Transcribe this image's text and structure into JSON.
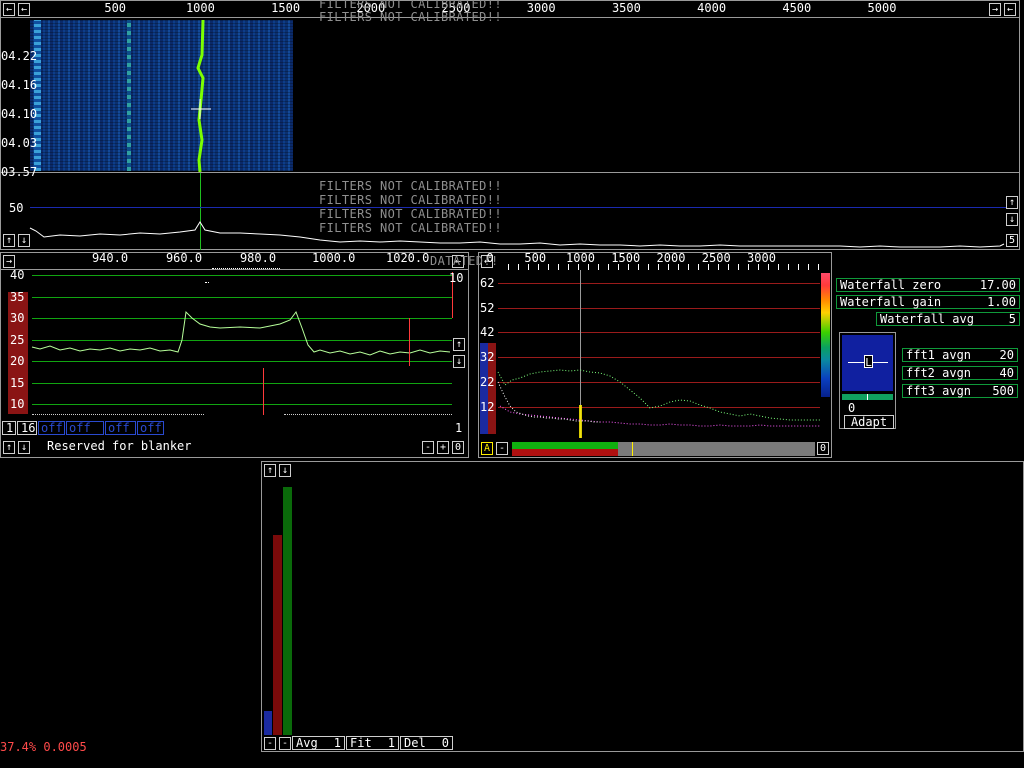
{
  "top_axis": {
    "ticks": [
      {
        "label": "500",
        "freq": 500
      },
      {
        "label": "1000",
        "freq": 1000
      },
      {
        "label": "1500",
        "freq": 1500
      },
      {
        "label": "2000",
        "freq": 2000
      },
      {
        "label": "2500",
        "freq": 2500
      },
      {
        "label": "3000",
        "freq": 3000
      },
      {
        "label": "3500",
        "freq": 3500
      },
      {
        "label": "4000",
        "freq": 4000
      },
      {
        "label": "4500",
        "freq": 4500
      },
      {
        "label": "5000",
        "freq": 5000
      }
    ],
    "left_arrow": "←",
    "right_arrow": "→",
    "left_arrow2": "←"
  },
  "waterfall": {
    "time_labels": [
      "04.22",
      "04.16",
      "04.10",
      "04.03",
      "03.57"
    ]
  },
  "warnings": {
    "text": "FILTERS NOT CALIBRATED!!",
    "text_lower": "DATATED!!"
  },
  "spectrum": {
    "y_label": "50",
    "up": "↑",
    "down": "↓",
    "level": "5"
  },
  "baseband": {
    "ticks": [
      {
        "label": "940.0",
        "freq": 940
      },
      {
        "label": "960.0",
        "freq": 960
      },
      {
        "label": "980.0",
        "freq": 980
      },
      {
        "label": "1000.0",
        "freq": 1000
      },
      {
        "label": "1020.0",
        "freq": 1020
      }
    ],
    "y_ticks": [
      {
        "label": "40",
        "db": 40
      },
      {
        "label": "35",
        "db": 35
      },
      {
        "label": "30",
        "db": 30
      },
      {
        "label": "25",
        "db": 25
      },
      {
        "label": "20",
        "db": 20
      },
      {
        "label": "15",
        "db": 15
      },
      {
        "label": "10",
        "db": 10
      }
    ],
    "right_value": "10",
    "buttons": {
      "b1": "1",
      "b16": "16",
      "off1": "off",
      "off2": "off",
      "off3": "off",
      "off4": "off",
      "right_one": "1"
    },
    "reserved": "Reserved for blanker",
    "minus": "-",
    "plus": "+",
    "zero": "0",
    "arrow_left": "←",
    "arrow_right": "→"
  },
  "af_graph": {
    "ticks": [
      {
        "label": "0",
        "freq": 0
      },
      {
        "label": "500",
        "freq": 500
      },
      {
        "label": "1000",
        "freq": 1000
      },
      {
        "label": "1500",
        "freq": 1500
      },
      {
        "label": "2000",
        "freq": 2000
      },
      {
        "label": "2500",
        "freq": 2500
      },
      {
        "label": "3000",
        "freq": 3000
      }
    ],
    "y_ticks": [
      {
        "label": "62",
        "db": 62
      },
      {
        "label": "52",
        "db": 52
      },
      {
        "label": "42",
        "db": 42
      },
      {
        "label": "32",
        "db": 32
      },
      {
        "label": "22",
        "db": 22
      },
      {
        "label": "12",
        "db": 12
      }
    ],
    "btn_a": "A",
    "btn_minus": "-",
    "btn_o": "0",
    "arrow_left": "←"
  },
  "params": {
    "wf_zero": {
      "label": "Waterfall zero",
      "value": "17.00"
    },
    "wf_gain": {
      "label": "Waterfall gain",
      "value": "1.00"
    },
    "wf_avg": {
      "label": "Waterfall avg",
      "value": "5"
    },
    "fft1": {
      "label": "fft1 avgn",
      "value": "20"
    },
    "fft2": {
      "label": "fft2 avgn",
      "value": "40"
    },
    "fft3": {
      "label": "fft3 avgn",
      "value": "500"
    },
    "meter_l": "L",
    "meter_zero": "0",
    "adapt": "Adapt"
  },
  "meter_window": {
    "up": "↑",
    "down": "↓",
    "minus1": "-",
    "minus2": "-",
    "avg": {
      "label": "Avg",
      "value": "1"
    },
    "fit": {
      "label": "Fit",
      "value": "1"
    },
    "del": {
      "label": "Del",
      "value": "0"
    }
  },
  "status": {
    "text": "37.4% 0.0005"
  },
  "colors": {
    "grid_green": "#11a511",
    "grid_red": "#9a1b1b",
    "trace_green": "#b7ff9a",
    "signal_green": "#7cff00",
    "cursor_red": "#ff3a3a",
    "status_red": "#ff4a4a"
  }
}
